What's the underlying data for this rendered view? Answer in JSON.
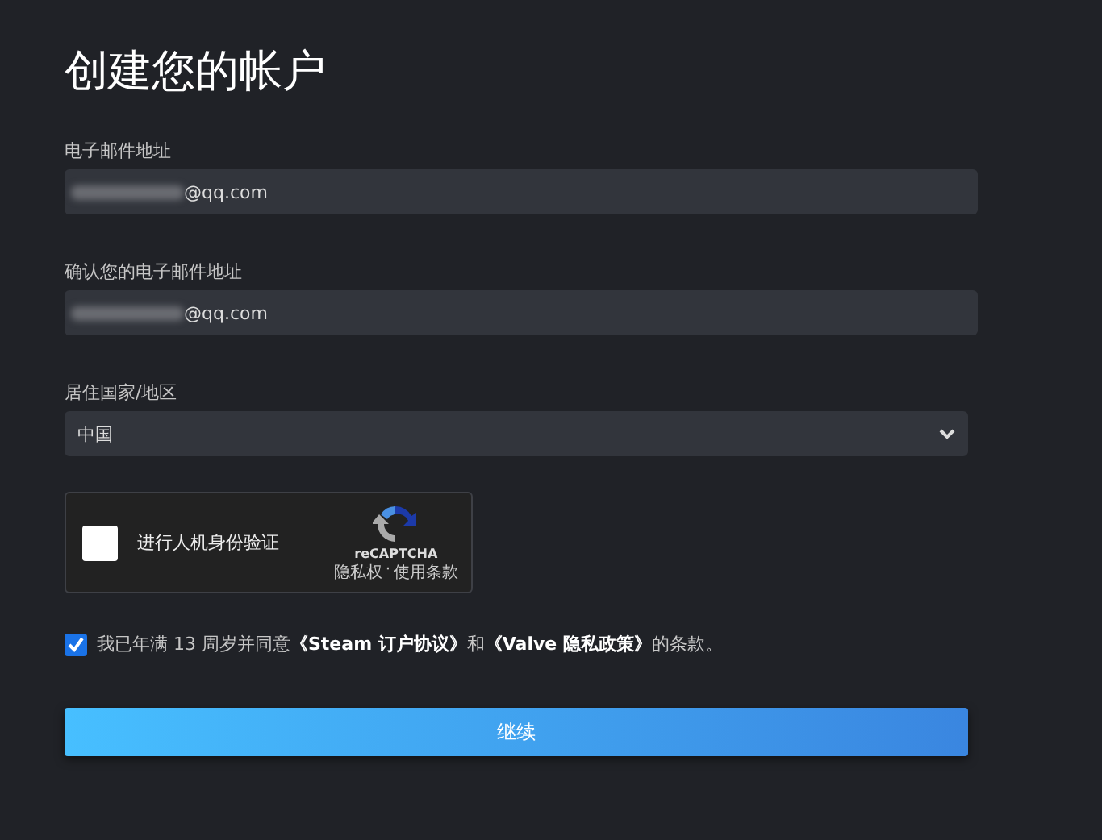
{
  "title": "创建您的帐户",
  "email": {
    "label": "电子邮件地址",
    "value": "@qq.com"
  },
  "confirm_email": {
    "label": "确认您的电子邮件地址",
    "value": "@qq.com"
  },
  "country": {
    "label": "居住国家/地区",
    "value": "中国"
  },
  "captcha": {
    "checked": false,
    "label": "进行人机身份验证",
    "brand": "reCAPTCHA",
    "links": [
      "隐私权",
      "使用条款"
    ],
    "separator": "·"
  },
  "agreement": {
    "checked": true,
    "parts": [
      {
        "kind": "text",
        "text": "我已年满 13 周岁并同意"
      },
      {
        "kind": "link",
        "text": "《Steam 订户协议》"
      },
      {
        "kind": "text",
        "text": "和"
      },
      {
        "kind": "link",
        "text": "《Valve 隐私政策》"
      },
      {
        "kind": "text",
        "text": "的条款。"
      }
    ]
  },
  "continue_button": "继续"
}
